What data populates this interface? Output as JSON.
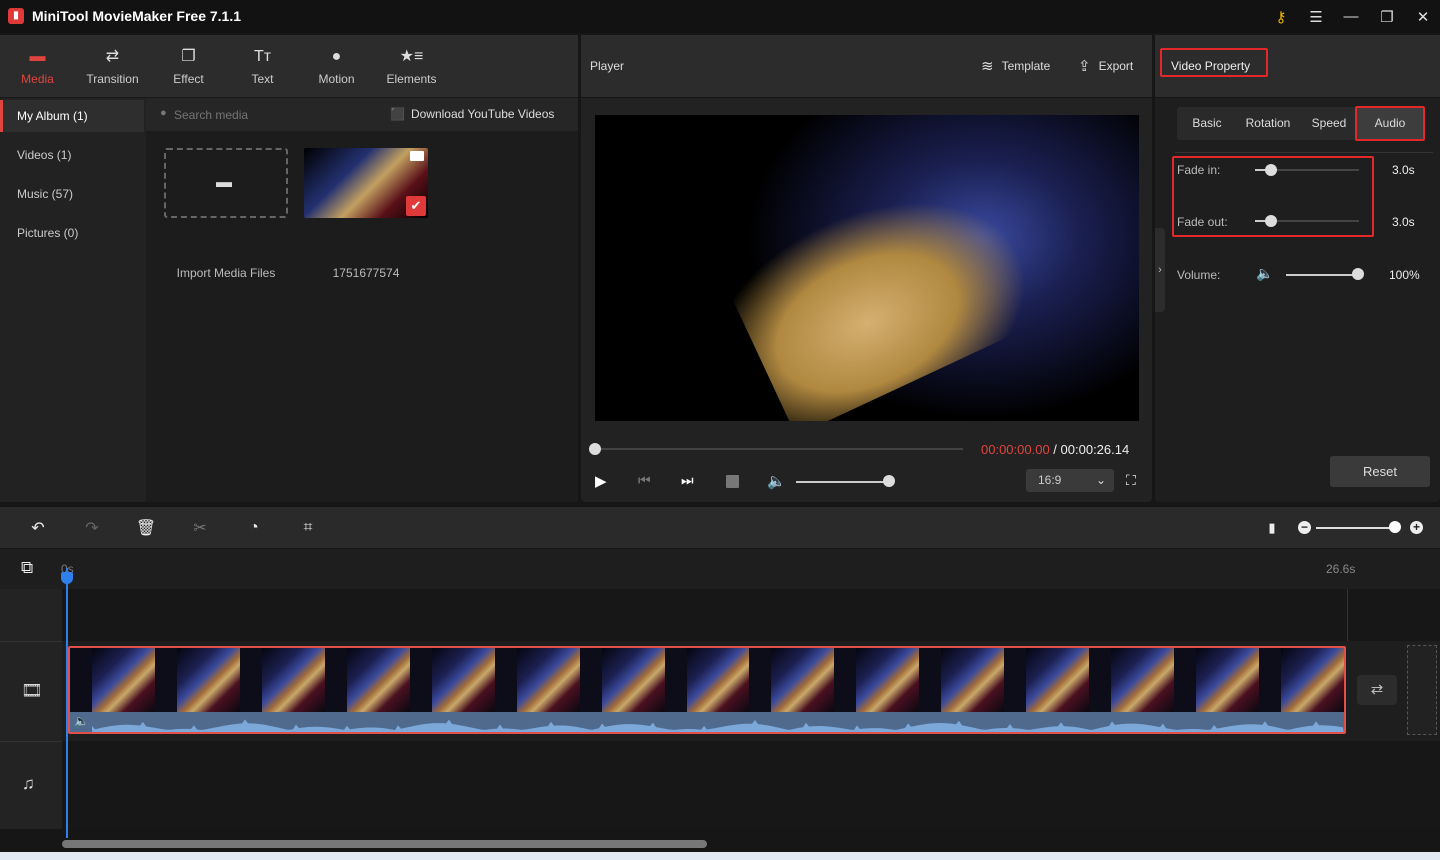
{
  "app": {
    "title": "MiniTool MovieMaker Free 7.1.1",
    "icon": "minitool-logo-icon"
  },
  "window_controls": [
    {
      "name": "key-icon",
      "glyph": "🔑"
    },
    {
      "name": "menu-icon",
      "glyph": "☰"
    },
    {
      "name": "minimize-icon",
      "glyph": "—"
    },
    {
      "name": "restore-icon",
      "glyph": "❐"
    },
    {
      "name": "close-icon",
      "glyph": "✕"
    }
  ],
  "tabs": [
    {
      "label": "Media",
      "icon": "folder-icon",
      "glyph": "▬",
      "active": true
    },
    {
      "label": "Transition",
      "icon": "swap-arrows-icon",
      "glyph": "⇄"
    },
    {
      "label": "Effect",
      "icon": "effect-layers-icon",
      "glyph": "❐"
    },
    {
      "label": "Text",
      "icon": "text-tt-icon",
      "glyph": "Tт"
    },
    {
      "label": "Motion",
      "icon": "motion-ball-icon",
      "glyph": "●"
    },
    {
      "label": "Elements",
      "icon": "elements-star-icon",
      "glyph": "★≡"
    }
  ],
  "albums": [
    {
      "label": "My Album (1)",
      "active": true
    },
    {
      "label": "Videos (1)"
    },
    {
      "label": "Music (57)"
    },
    {
      "label": "Pictures (0)"
    }
  ],
  "media": {
    "search_placeholder": "Search media",
    "download_label": "Download YouTube Videos",
    "import_label": "Import Media Files",
    "clip_name": "1751677574"
  },
  "player": {
    "title": "Player",
    "template_label": "Template",
    "export_label": "Export",
    "current_time": "00:00:00.00",
    "separator": " / ",
    "total_time": "00:00:26.14",
    "progress": 0,
    "volume": 1.0,
    "aspect_ratio": "16:9"
  },
  "property": {
    "title": "Video Property",
    "tabs": [
      "Basic",
      "Rotation",
      "Speed",
      "Audio"
    ],
    "active_tab": "Audio",
    "fade_in_label": "Fade in:",
    "fade_in_value": "3.0s",
    "fade_in_fraction": 0.15,
    "fade_out_label": "Fade out:",
    "fade_out_value": "3.0s",
    "fade_out_fraction": 0.15,
    "volume_label": "Volume:",
    "volume_value": "100%",
    "volume_fraction": 1.0,
    "reset_label": "Reset"
  },
  "timeline": {
    "start_label": "0s",
    "end_label": "26.6s",
    "zoom_fraction": 1.0,
    "frame_count": 15,
    "accent": "#2f80ed",
    "clip_border": "#e2504c"
  }
}
